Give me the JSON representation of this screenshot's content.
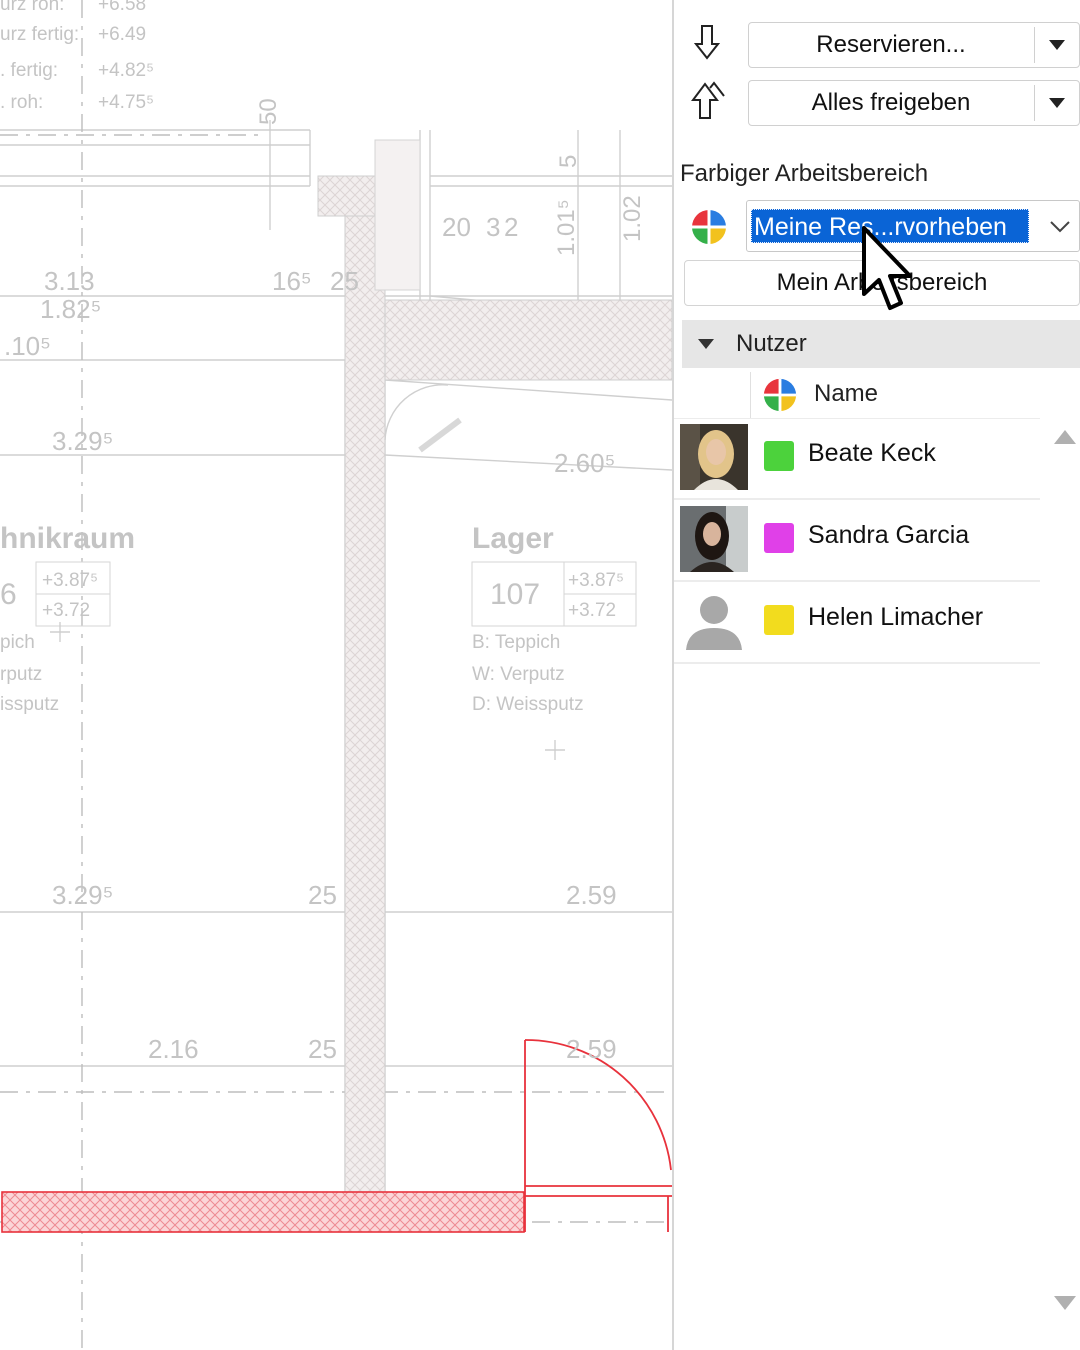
{
  "plan": {
    "texts": [
      "urz roh:",
      "+6.58",
      "urz fertig:",
      "+6.49",
      ". fertig:",
      "+4.82⁵",
      ". roh:",
      "+4.75⁵",
      "50",
      "5",
      "1.02",
      "1.01⁵",
      "20",
      "3",
      "2",
      "3.13",
      "1.82⁵",
      "16⁵",
      "25",
      ".10⁵",
      "3.29⁵",
      "2.60⁵",
      "hnikraum",
      "6",
      "+3.87⁵",
      "+3.72",
      "pich",
      "rputz",
      "issputz",
      "Lager",
      "107",
      "+3.87⁵",
      "+3.72",
      "B: Teppich",
      "W: Verputz",
      "D: Weissputz",
      "3.29⁵",
      "25",
      "2.59",
      "2.16",
      "25",
      "2.59"
    ]
  },
  "panel": {
    "reserve_label": "Reservieren...",
    "release_label": "Alles freigeben",
    "section_title": "Farbiger Arbeitsbereich",
    "combo_value": "Meine Res...rvorheben",
    "workspace_button": "Mein Arbeitsbereich",
    "group_label": "Nutzer",
    "column_name": "Name",
    "users": [
      {
        "name": "Beate Keck",
        "color": "#4cd23c"
      },
      {
        "name": "Sandra Garcia",
        "color": "#e040e8"
      },
      {
        "name": "Helen Limacher",
        "color": "#f2dc1e"
      }
    ],
    "colors": {
      "selection": "#0a64d6",
      "door_red": "#e8323c",
      "hatch_red": "#f5b4b8"
    }
  }
}
